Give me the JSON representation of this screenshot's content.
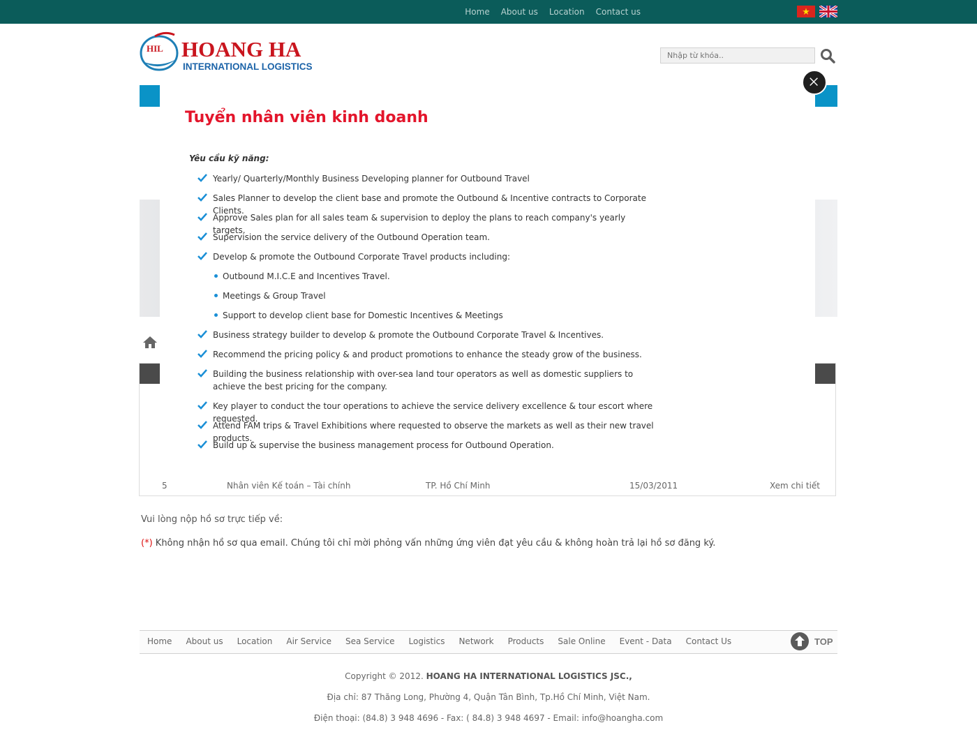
{
  "top_nav": [
    "Home",
    "About us",
    "Location",
    "Contact us"
  ],
  "search": {
    "placeholder": "Nhập từ khóa.."
  },
  "logo": {
    "mark": "HIL",
    "name": "HOANG HA",
    "tagline": "INTERNATIONAL LOGISTICS"
  },
  "table_rows": [
    {
      "num": "5",
      "title": "Nhân viên Kế toán – Tài chính",
      "location": "TP. Hồ Chí Minh",
      "date": "15/03/2011",
      "link": "Xem chi tiết"
    }
  ],
  "notes": {
    "submit": "Vui lòng nộp hồ sơ trực tiếp về:",
    "star": "(*)",
    "warning": "Không nhận hồ sơ qua email. Chúng tôi chỉ mời phỏng vấn những ứng viên đạt yêu cầu & không hoàn trả lại hồ sơ đăng ký."
  },
  "footer_nav": [
    "Home",
    "About us",
    "Location",
    "Air Service",
    "Sea Service",
    "Logistics",
    "Network",
    "Products",
    "Sale Online",
    "Event - Data",
    "Contact Us"
  ],
  "top_button": "TOP",
  "footer": {
    "copyright_prefix": "Copyright © 2012.",
    "company": "HOANG HA INTERNATIONAL LOGISTICS JSC.,",
    "address": "Địa chỉ: 87 Thăng Long, Phường 4, Quận Tân Bình, Tp.Hồ Chí Minh, Việt Nam.",
    "contact": "Điện thoại: (84.8) 3 948 4696 - Fax: ( 84.8) 3 948 4697 - Email: info@hoangha.com"
  },
  "modal": {
    "title": "Tuyển nhân viên kinh doanh",
    "requirements_label": "Yêu cầu kỹ năng:",
    "items": [
      "Yearly/ Quarterly/Monthly Business Developing planner for Outbound Travel",
      "Sales Planner to develop the client base and promote the Outbound & Incentive contracts to Corporate Clients.",
      "Approve Sales plan for all sales team & supervision to deploy the plans to reach company's yearly targets.",
      "Supervision the service delivery of the Outbound Operation team.",
      "Develop & promote the Outbound Corporate Travel products including:"
    ],
    "subitems": [
      "Outbound M.I.C.E and Incentives Travel.",
      "Meetings & Group Travel",
      "Support to develop client base for Domestic Incentives & Meetings"
    ],
    "items2": [
      "Business strategy builder to develop & promote the Outbound Corporate Travel & Incentives.",
      "Recommend the pricing policy & and product promotions to enhance the steady grow of the business.",
      "Building the business relationship with over-sea land tour operators as well as domestic suppliers to achieve the best pricing for the company.",
      "Key player to conduct the tour operations to achieve the service delivery excellence & tour escort where requested.",
      "Attend FAM trips & Travel Exhibitions where requested to observe the markets as well as their new travel products.",
      "Build up & supervise the business management process for Outbound Operation."
    ]
  },
  "colors": {
    "topbar": "#0b5c5a",
    "mainnav": "#0a93c7",
    "title_red": "#e3152b",
    "check_blue": "#1a8fd6"
  }
}
